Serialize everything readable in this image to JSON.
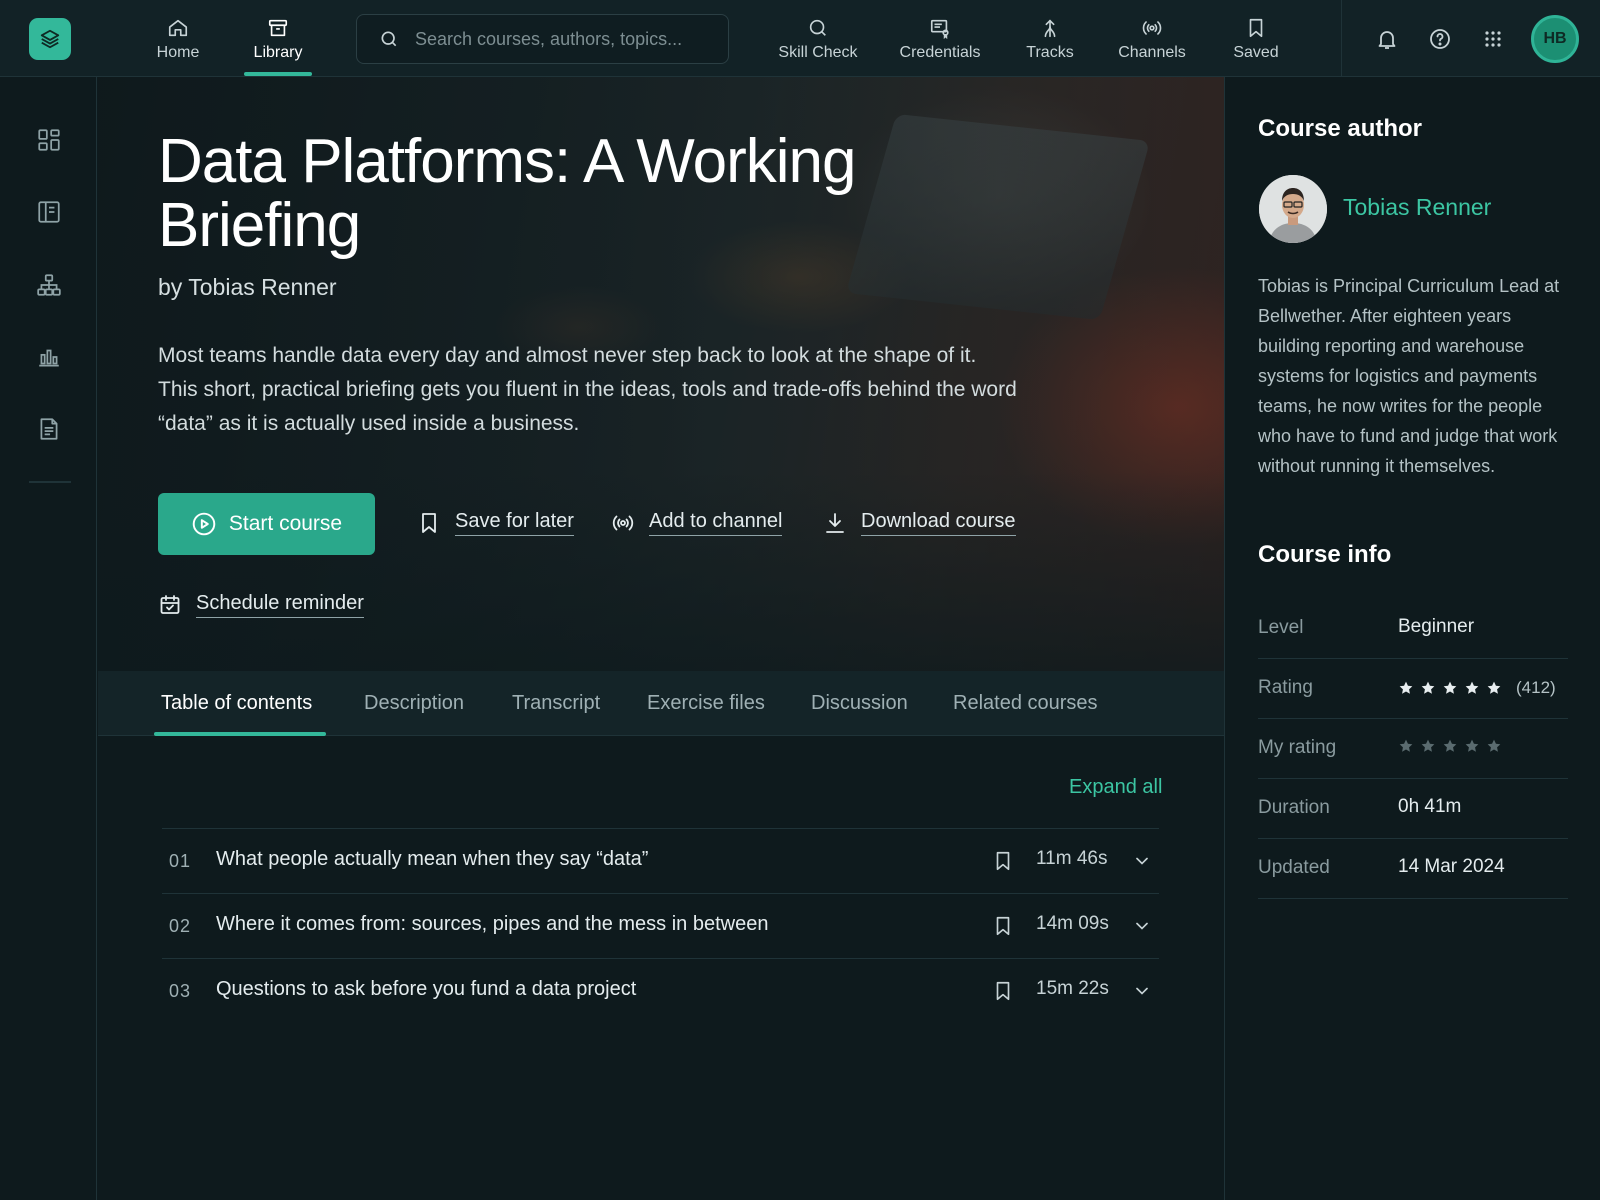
{
  "topbar": {
    "nav": [
      {
        "label": "Home",
        "icon": "home-icon"
      },
      {
        "label": "Library",
        "icon": "archive-icon",
        "active": true
      },
      {
        "label": "Skill Check",
        "icon": "search-icon"
      },
      {
        "label": "Credentials",
        "icon": "credential-icon"
      },
      {
        "label": "Tracks",
        "icon": "tracks-icon"
      },
      {
        "label": "Channels",
        "icon": "broadcast-icon"
      },
      {
        "label": "Saved",
        "icon": "bookmark-icon"
      }
    ],
    "search_placeholder": "Search courses, authors, topics...",
    "avatar_initials": "HB"
  },
  "hero": {
    "title": "Data Platforms: A Working Briefing",
    "author": "by Tobias Renner",
    "description": "Most teams handle data every day and almost never step back to look at the shape of it. This short, practical briefing gets you fluent in the ideas, tools and trade-offs behind the word “data” as it is actually used inside a business.",
    "start_label": "Start course",
    "save_label": "Save for later",
    "channel_label": "Add to channel",
    "download_label": "Download course",
    "reminder_label": "Schedule reminder"
  },
  "tabs": [
    "Table of contents",
    "Description",
    "Transcript",
    "Exercise files",
    "Discussion",
    "Related courses"
  ],
  "toc": {
    "expand_label": "Expand all",
    "items": [
      {
        "num": "01",
        "title": "What people actually mean when they say “data”",
        "duration": "11m 46s"
      },
      {
        "num": "02",
        "title": "Where it comes from: sources, pipes and the mess in between",
        "duration": "14m 09s"
      },
      {
        "num": "03",
        "title": "Questions to ask before you fund a data project",
        "duration": "15m 22s"
      }
    ]
  },
  "author_panel": {
    "heading": "Course author",
    "name": "Tobias Renner",
    "bio": "Tobias is Principal Curriculum Lead at Bellwether. After eighteen years building reporting and warehouse systems for logistics and payments teams, he now writes for the people who have to fund and judge that work without running it themselves."
  },
  "info_panel": {
    "heading": "Course info",
    "level_label": "Level",
    "level": "Beginner",
    "rating_label": "Rating",
    "rating_stars": 5,
    "rating_count": "(412)",
    "my_rating_label": "My rating",
    "my_rating_stars": 0,
    "duration_label": "Duration",
    "duration": "0h 41m",
    "updated_label": "Updated",
    "updated": "14 Mar 2024"
  },
  "colors": {
    "accent": "#33b89a",
    "accent_text": "#3cc6a3",
    "background": "#0e1a1d"
  }
}
